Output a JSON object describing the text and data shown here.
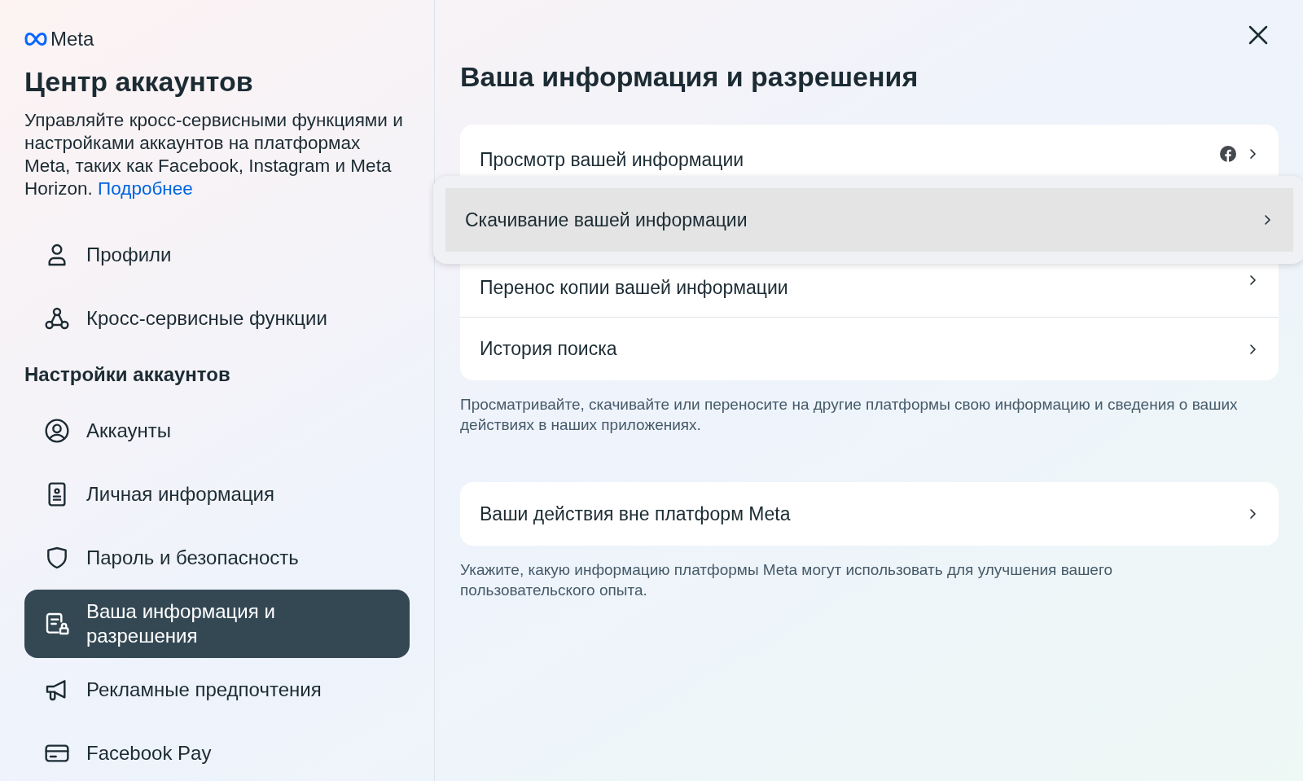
{
  "brand": {
    "name": "Meta"
  },
  "sidebar": {
    "title": "Центр аккаунтов",
    "description": "Управляйте кросс-сервисными функциями и настройками аккаунтов на платформах Meta, таких как Facebook, Instagram и Meta Horizon.",
    "link": "Подробнее",
    "top_items": [
      {
        "label": "Профили",
        "kind": "person",
        "selected": false
      },
      {
        "label": "Кросс-сервисные функции",
        "kind": "nodes",
        "selected": false
      }
    ],
    "section_title": "Настройки аккаунтов",
    "items": [
      {
        "label": "Аккаунты",
        "kind": "account",
        "selected": false
      },
      {
        "label": "Личная информация",
        "kind": "idcard",
        "selected": false
      },
      {
        "label": "Пароль и безопасность",
        "kind": "shield",
        "selected": false
      },
      {
        "label": "Ваша информация и разрешения",
        "kind": "docs",
        "selected": true
      },
      {
        "label": "Рекламные предпочтения",
        "kind": "megaphone",
        "selected": false
      },
      {
        "label": "Facebook Pay",
        "kind": "card",
        "selected": false
      }
    ]
  },
  "main": {
    "title": "Ваша информация и разрешения",
    "groups": [
      {
        "items": [
          {
            "label": "Просмотр вашей информации",
            "facebook_badge": true,
            "highlighted": false
          },
          {
            "label": "Скачивание вашей информации",
            "facebook_badge": false,
            "highlighted": true
          },
          {
            "label": "Перенос копии вашей информации",
            "facebook_badge": false,
            "highlighted": false
          },
          {
            "label": "История поиска",
            "facebook_badge": false,
            "highlighted": false
          }
        ],
        "note": "Просматривайте, скачивайте или переносите на другие платформы свою информацию и сведения о ваших действиях в наших приложениях."
      },
      {
        "items": [
          {
            "label": "Ваши действия вне платформ Meta",
            "facebook_badge": false,
            "highlighted": false
          }
        ],
        "note": "Укажите, какую информацию платформы Meta могут использовать для улучшения вашего пользовательского опыта."
      }
    ]
  }
}
